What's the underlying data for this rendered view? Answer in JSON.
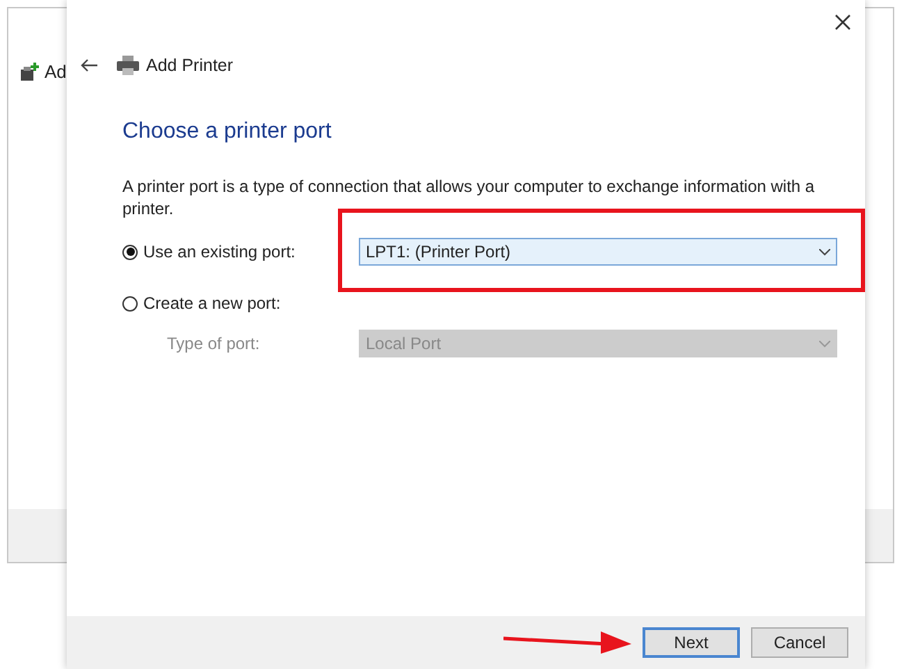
{
  "background_window": {
    "title": "Ad"
  },
  "dialog": {
    "title": "Add Printer",
    "heading": "Choose a printer port",
    "description": "A printer port is a type of connection that allows your computer to exchange information with a printer.",
    "options": [
      {
        "label": "Use an existing port:",
        "selected": true,
        "dropdown": {
          "value": "LPT1: (Printer Port)",
          "disabled": false,
          "highlighted": true
        }
      },
      {
        "label": "Create a new port:",
        "selected": false
      }
    ],
    "port_type": {
      "label": "Type of port:",
      "value": "Local Port",
      "disabled": true
    },
    "buttons": [
      {
        "label": "Next",
        "default": true,
        "arrow_pointer": true
      },
      {
        "label": "Cancel",
        "default": false,
        "arrow_pointer": false
      }
    ]
  }
}
